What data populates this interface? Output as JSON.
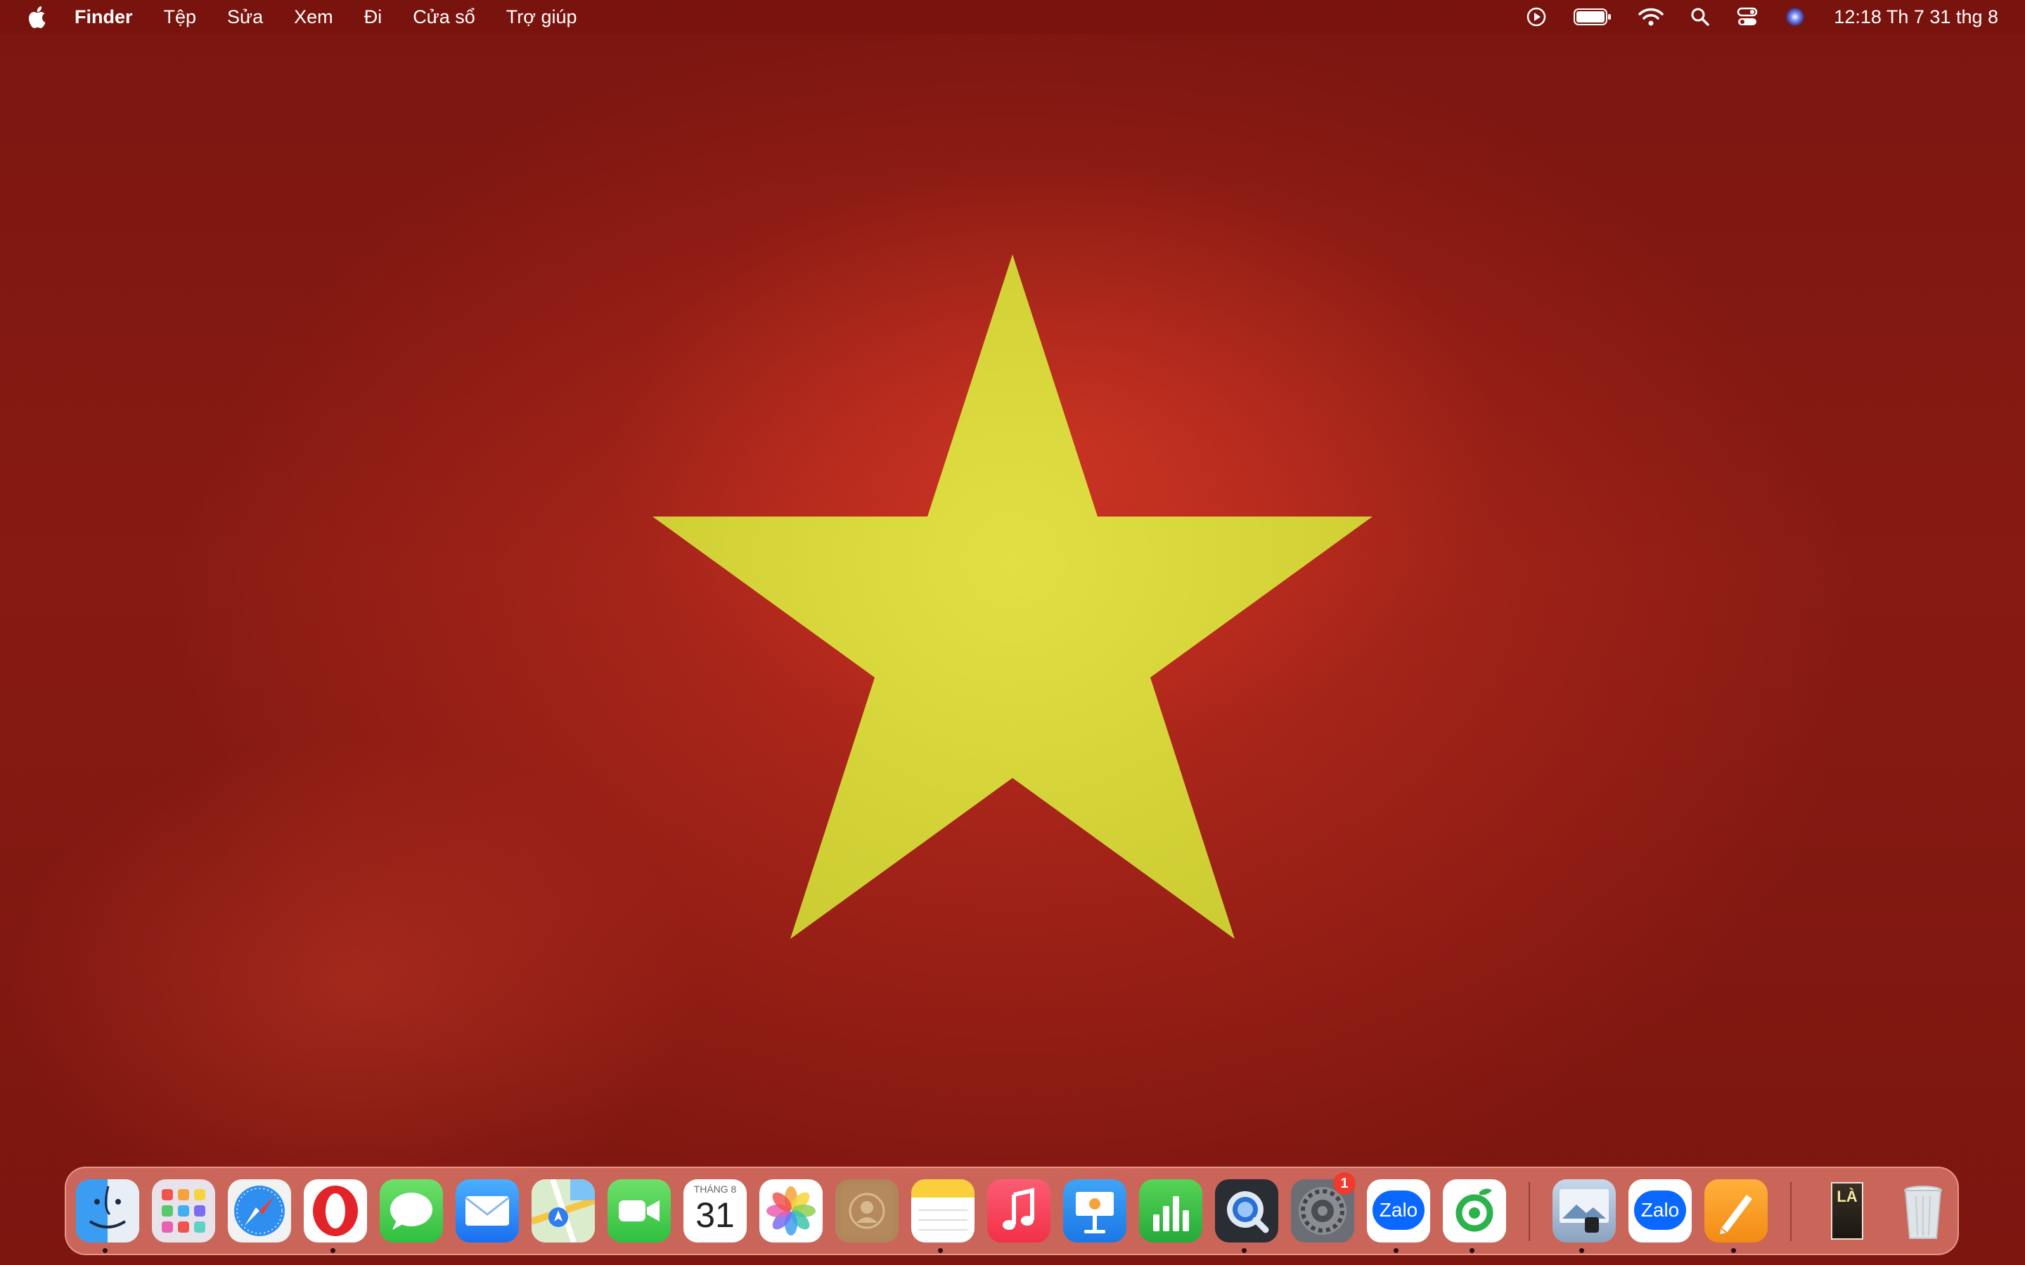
{
  "menubar": {
    "apple_icon": "apple-icon",
    "app_name": "Finder",
    "menus": [
      "Tệp",
      "Sửa",
      "Xem",
      "Đi",
      "Cửa sổ",
      "Trợ giúp"
    ],
    "status_icons": [
      "screen-record-icon",
      "battery-icon",
      "wifi-icon",
      "search-icon",
      "control-center-icon",
      "siri-icon"
    ],
    "clock": "12:18 Th 7 31 thg 8"
  },
  "wallpaper": {
    "description_colors": {
      "red": "#b3251b",
      "star": "#d9e03a"
    }
  },
  "dock": {
    "apps": [
      {
        "name": "Finder",
        "icon": "finder-icon",
        "running": true
      },
      {
        "name": "Launchpad",
        "icon": "launchpad-icon",
        "running": false
      },
      {
        "name": "Safari",
        "icon": "safari-icon",
        "running": false
      },
      {
        "name": "Opera",
        "icon": "opera-icon",
        "running": true
      },
      {
        "name": "Messages",
        "icon": "messages-icon",
        "running": false
      },
      {
        "name": "Mail",
        "icon": "mail-icon",
        "running": false
      },
      {
        "name": "Maps",
        "icon": "maps-icon",
        "running": false
      },
      {
        "name": "FaceTime",
        "icon": "facetime-icon",
        "running": false
      },
      {
        "name": "Calendar",
        "icon": "calendar-icon",
        "running": false,
        "month": "THÁNG 8",
        "day": "31"
      },
      {
        "name": "Photos",
        "icon": "photos-icon",
        "running": false
      },
      {
        "name": "Contacts",
        "icon": "contacts-icon",
        "running": false
      },
      {
        "name": "Notes",
        "icon": "notes-icon",
        "running": true
      },
      {
        "name": "Music",
        "icon": "music-icon",
        "running": false
      },
      {
        "name": "Keynote",
        "icon": "keynote-icon",
        "running": false
      },
      {
        "name": "Numbers",
        "icon": "numbers-icon",
        "running": false
      },
      {
        "name": "QuickTime Player",
        "icon": "quicktime-icon",
        "running": true
      },
      {
        "name": "System Settings",
        "icon": "settings-icon",
        "running": false,
        "badge": "1"
      },
      {
        "name": "Zalo",
        "icon": "zalo-icon",
        "running": true,
        "label": "Zalo"
      },
      {
        "name": "Cốc Cốc",
        "icon": "coccoc-icon",
        "running": true
      },
      {
        "name": "Preview",
        "icon": "preview-icon",
        "running": true
      },
      {
        "name": "Zalo",
        "icon": "zalo-icon-2",
        "running": false,
        "label": "Zalo"
      },
      {
        "name": "Pages",
        "icon": "pages-icon",
        "running": true
      },
      {
        "name": "Downloads stack",
        "icon": "stack-thumbnail-icon",
        "running": false,
        "thumb_text": "LÀ"
      },
      {
        "name": "Trash",
        "icon": "trash-icon",
        "running": false
      }
    ]
  }
}
